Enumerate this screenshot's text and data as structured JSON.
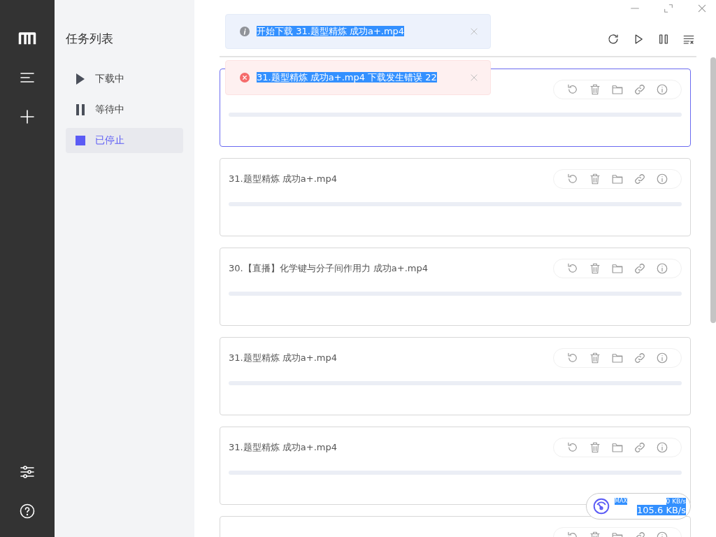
{
  "nav": {
    "top": [
      {
        "kind": "logo"
      },
      {
        "kind": "menu"
      },
      {
        "kind": "add"
      }
    ],
    "bottom": [
      {
        "kind": "settings"
      },
      {
        "kind": "help"
      }
    ]
  },
  "task_list": {
    "title": "任务列表",
    "items": [
      {
        "label": "下载中",
        "kind": "play",
        "selected": false
      },
      {
        "label": "等待中",
        "kind": "pause",
        "selected": false
      },
      {
        "label": "已停止",
        "kind": "stop",
        "selected": true
      }
    ]
  },
  "notifications": [
    {
      "kind": "info",
      "message": "开始下载 31.题型精炼 成功a+.mp4",
      "selected_text": true
    },
    {
      "kind": "error",
      "message": "31.题型精炼 成功a+.mp4 下载发生错误 22",
      "selected_text": true
    }
  ],
  "tasks": [
    {
      "selected": true
    },
    {
      "title": "31.题型精炼 成功a+.mp4",
      "selected": false
    },
    {
      "title": "30.【直播】化学键与分子间作用力 成功a+.mp4",
      "selected": false
    },
    {
      "title": "31.题型精炼 成功a+.mp4",
      "selected": false
    },
    {
      "title": "31.题型精炼 成功a+.mp4",
      "selected": false
    },
    {
      "selected": false
    }
  ],
  "speed": {
    "limit_label": "MAX",
    "upload": "0 KB/s",
    "download": "105.6 KB/s",
    "selected_text": true
  }
}
